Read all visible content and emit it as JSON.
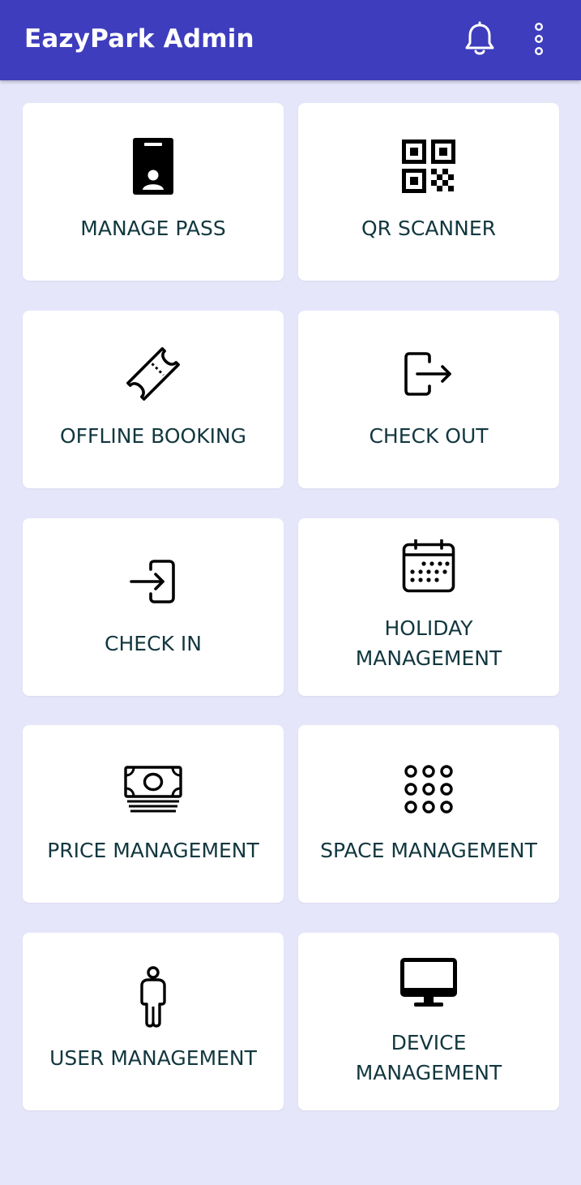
{
  "app": {
    "title": "EazyPark Admin",
    "colors": {
      "appbar": "#3e3dbd",
      "background": "#e6e6fb",
      "tile": "#ffffff",
      "label": "#12373f"
    }
  },
  "appbar": {
    "actions": [
      {
        "icon": "bell-icon"
      },
      {
        "icon": "more-vert-icon"
      }
    ]
  },
  "tiles": [
    {
      "label": "MANAGE PASS",
      "icon": "id-badge-icon"
    },
    {
      "label": "QR SCANNER",
      "icon": "qr-code-icon"
    },
    {
      "label": "OFFLINE BOOKING",
      "icon": "ticket-icon"
    },
    {
      "label": "CHECK OUT",
      "icon": "logout-icon"
    },
    {
      "label": "CHECK IN",
      "icon": "login-icon"
    },
    {
      "label": "HOLIDAY\nMANAGEMENT",
      "icon": "calendar-icon"
    },
    {
      "label": "PRICE MANAGEMENT",
      "icon": "money-icon"
    },
    {
      "label": "SPACE MANAGEMENT",
      "icon": "grid-dots-icon"
    },
    {
      "label": "USER MANAGEMENT",
      "icon": "person-icon"
    },
    {
      "label": "DEVICE\nMANAGEMENT",
      "icon": "monitor-icon"
    }
  ]
}
